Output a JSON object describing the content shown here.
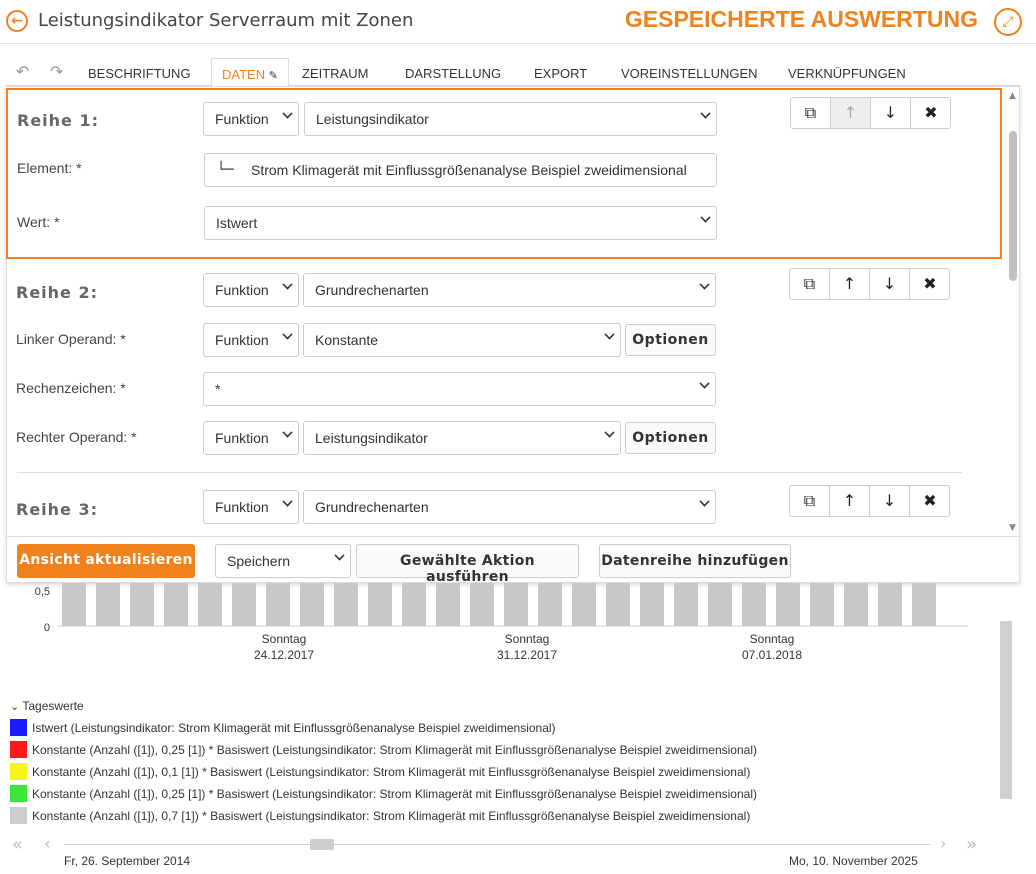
{
  "header": {
    "title": "Leistungsindikator Serverraum mit Zonen",
    "saved_label": "GESPEICHERTE AUSWERTUNG",
    "back_icon": "arrow-left-circle-icon",
    "expand_icon": "expand-icon"
  },
  "tabs": [
    {
      "label": "BESCHRIFTUNG"
    },
    {
      "label": "DATEN"
    },
    {
      "label": "ZEITRAUM"
    },
    {
      "label": "DARSTELLUNG"
    },
    {
      "label": "EXPORT"
    },
    {
      "label": "VOREINSTELLUNGEN"
    },
    {
      "label": "VERKNÜPFUNGEN"
    }
  ],
  "rows": {
    "r1": {
      "label": "Reihe 1:",
      "type": "Funktion",
      "function": "Leistungsindikator",
      "element_label": "Element: *",
      "element_value": "Strom Klimagerät mit Einflussgrößenanalyse Beispiel zweidimensional",
      "wert_label": "Wert: *",
      "wert_value": "Istwert"
    },
    "r2": {
      "label": "Reihe 2:",
      "type": "Funktion",
      "function": "Grundrechenarten",
      "left_label": "Linker Operand: *",
      "left_type": "Funktion",
      "left_value": "Konstante",
      "op_label": "Rechenzeichen: *",
      "op_value": "*",
      "right_label": "Rechter Operand: *",
      "right_type": "Funktion",
      "right_value": "Leistungsindikator"
    },
    "r3": {
      "label": "Reihe 3:",
      "type": "Funktion",
      "function": "Grundrechenarten"
    },
    "options_label": "Optionen"
  },
  "footer": {
    "refresh": "Ansicht aktualisieren",
    "action_select": "Speichern",
    "execute": "Gewählte Aktion ausführen",
    "add_row": "Datenreihe hinzufügen"
  },
  "chart_data": {
    "type": "bar",
    "yticks": [
      "0,5",
      "0"
    ],
    "xticks": [
      {
        "day": "Sonntag",
        "date": "24.12.2017"
      },
      {
        "day": "Sonntag",
        "date": "31.12.2017"
      },
      {
        "day": "Sonntag",
        "date": "07.01.2018"
      }
    ],
    "bar_color": "#c8c8c8"
  },
  "legend": {
    "title": "Tageswerte",
    "items": [
      {
        "color": "#1a1aff",
        "label": "Istwert (Leistungsindikator: Strom Klimagerät mit Einflussgrößenanalyse Beispiel zweidimensional)"
      },
      {
        "color": "#ff1a1a",
        "label": "Konstante (Anzahl ([1]), 0,25 [1]) * Basiswert (Leistungsindikator: Strom Klimagerät mit Einflussgrößenanalyse Beispiel zweidimensional)"
      },
      {
        "color": "#f5f51a",
        "label": "Konstante (Anzahl ([1]), 0,1 [1]) * Basiswert (Leistungsindikator: Strom Klimagerät mit Einflussgrößenanalyse Beispiel zweidimensional)"
      },
      {
        "color": "#3ae63a",
        "label": "Konstante (Anzahl ([1]), 0,25 [1]) * Basiswert (Leistungsindikator: Strom Klimagerät mit Einflussgrößenanalyse Beispiel zweidimensional)"
      },
      {
        "color": "#cccccc",
        "label": "Konstante (Anzahl ([1]), 0,7 [1]) * Basiswert (Leistungsindikator: Strom Klimagerät mit Einflussgrößenanalyse Beispiel zweidimensional)"
      }
    ]
  },
  "timeline": {
    "start": "Fr, 26. September 2014",
    "end": "Mo, 10. November 2025"
  }
}
